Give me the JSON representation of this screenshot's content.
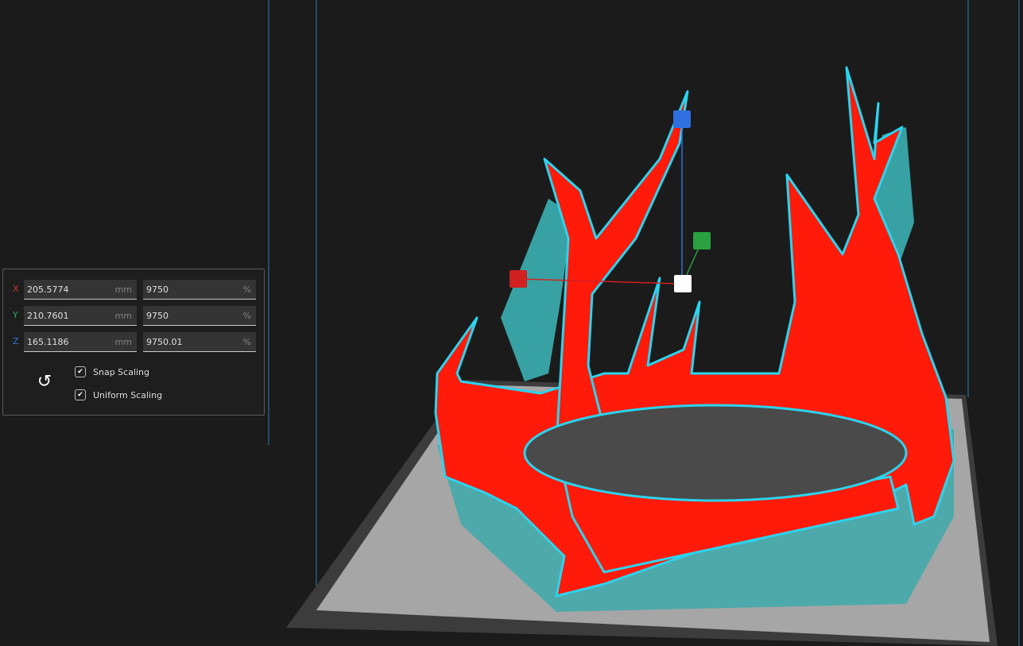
{
  "scale_panel": {
    "rows": [
      {
        "axis": "X",
        "axis_color": "#c0392b",
        "size": "205.5774",
        "size_unit": "mm",
        "percent": "9750",
        "percent_unit": "%"
      },
      {
        "axis": "Y",
        "axis_color": "#27ae60",
        "size": "210.7601",
        "size_unit": "mm",
        "percent": "9750",
        "percent_unit": "%"
      },
      {
        "axis": "Z",
        "axis_color": "#3a6fd8",
        "size": "165.1186",
        "size_unit": "mm",
        "percent": "9750.01",
        "percent_unit": "%"
      }
    ],
    "snap_scaling": {
      "label": "Snap Scaling",
      "checked": true
    },
    "uniform_scaling": {
      "label": "Uniform Scaling",
      "checked": true
    },
    "reset_icon": "rotate-ccw-icon"
  },
  "colors": {
    "model": "#ff1a0a",
    "outline": "#2ad4ef",
    "support": "#3aa9ab",
    "plate": "#a6a6a6"
  }
}
